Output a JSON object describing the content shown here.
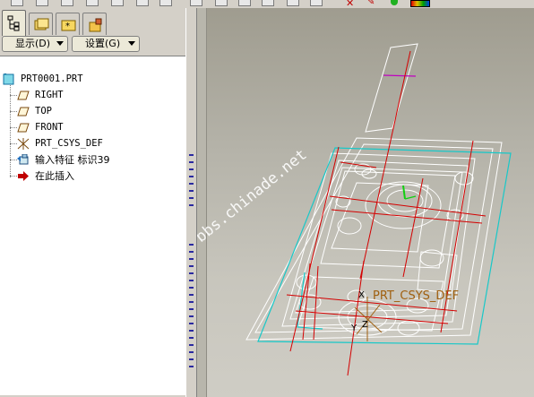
{
  "tabs": [
    {
      "name": "model-tree",
      "icon": "model-tree-icon",
      "active": true
    },
    {
      "name": "folder",
      "icon": "folder-browser-icon",
      "active": false
    },
    {
      "name": "favorites",
      "icon": "favorites-icon",
      "active": false
    },
    {
      "name": "connections",
      "icon": "connections-icon",
      "active": false
    }
  ],
  "toolbar": {
    "show_label": "显示(D)",
    "settings_label": "设置(G)"
  },
  "tree": {
    "root": "PRT0001.PRT",
    "items": [
      {
        "label": "RIGHT",
        "icon": "datum-plane-icon"
      },
      {
        "label": "TOP",
        "icon": "datum-plane-icon"
      },
      {
        "label": "FRONT",
        "icon": "datum-plane-icon"
      },
      {
        "label": "PRT_CSYS_DEF",
        "icon": "csys-icon"
      },
      {
        "label": "输入特征 标识39",
        "icon": "import-feature-icon"
      },
      {
        "label": "在此插入",
        "icon": "insert-here-arrow-icon"
      }
    ]
  },
  "viewport": {
    "csys_label": "PRT_CSYS_DEF",
    "csys_x": "X",
    "csys_y": "Y",
    "csys_z": "Z",
    "watermark": "bbs.chinade.net"
  },
  "colors": {
    "accent_red": "#d40000",
    "insert_arrow": "#c00000",
    "cyan_edge": "#18c8c8",
    "csys_label": "#a06010",
    "magenta_mark": "#c000c0",
    "green_axis": "#10d010"
  }
}
